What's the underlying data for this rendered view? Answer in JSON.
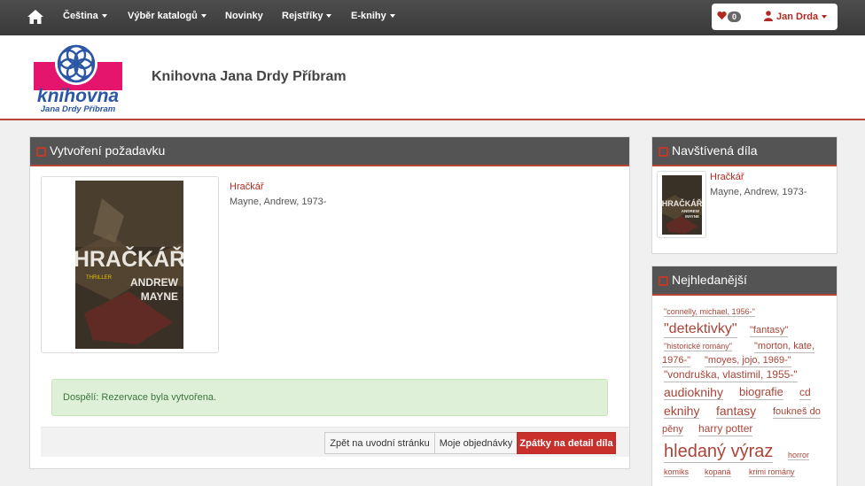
{
  "nav": {
    "items": [
      {
        "label": "Čeština",
        "dropdown": true
      },
      {
        "label": "Výběr katalogů",
        "dropdown": true
      },
      {
        "label": "Novinky",
        "dropdown": false
      },
      {
        "label": "Rejstříky",
        "dropdown": true
      },
      {
        "label": "E-knihy",
        "dropdown": true
      }
    ],
    "favorites_count": "0",
    "user_name": "Jan Drda"
  },
  "header": {
    "logo_text_main": "knihovna",
    "logo_text_sub": "Jana Drdy Příbram",
    "library_title": "Knihovna Jana Drdy Příbram"
  },
  "request_panel": {
    "heading": "Vytvoření požadavku",
    "book": {
      "cover_title": "HRAČKÁŘ",
      "cover_author_line1": "ANDREW",
      "cover_author_line2": "MAYNE",
      "cover_genre": "THRILLER",
      "title": "Hračkář",
      "author": "Mayne, Andrew, 1973-"
    },
    "alert_text": "Dospělí: Rezervace byla vytvořena.",
    "buttons": {
      "home": "Zpět na uvodní stránku",
      "orders": "Moje objednávky",
      "back": "Zpátky na detail díla"
    }
  },
  "visited_panel": {
    "heading": "Navštívená díla",
    "title": "Hračkář",
    "author": "Mayne, Andrew, 1973-"
  },
  "tags_panel": {
    "heading": "Nejhledanější",
    "tags": [
      "\"connelly, michael, 1956-\"",
      "\"detektivky\"",
      "\"fantasy\"",
      "\"historické romány\"",
      "\"morton, kate,",
      "1976-\"",
      "\"moyes, jojo, 1969-\"",
      "\"vondruška, vlastimil, 1955-\"",
      "audioknihy",
      "biografie",
      "cd",
      "eknihy",
      "fantasy",
      "foukneš do",
      "pěny",
      "harry potter",
      "hledaný výraz",
      "horror",
      "komiks",
      "kopaná",
      "krimi romány"
    ]
  },
  "colors": {
    "accent": "#b12a21",
    "navbar": "#444444",
    "panel_heading": "#545454",
    "success_bg": "#dff0d8",
    "danger_button": "#c9302c"
  }
}
